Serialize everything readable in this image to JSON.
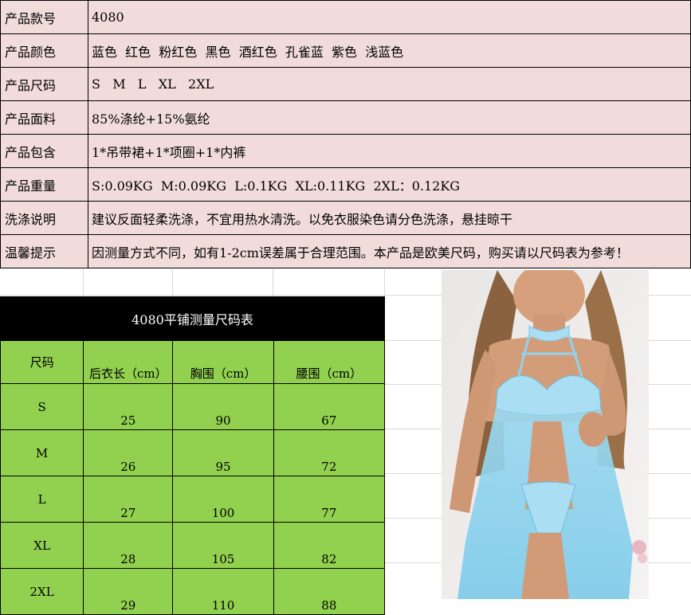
{
  "info_rows": [
    {
      "key": "产品款号",
      "value": "4080"
    },
    {
      "key": "产品颜色",
      "value": "蓝色  红色  粉红色  黑色  酒红色  孔雀蓝  紫色  浅蓝色"
    },
    {
      "key": "产品尺码",
      "value": "S   M   L   XL   2XL"
    },
    {
      "key": "产品面料",
      "value": "85%涤纶+15%氨纶"
    },
    {
      "key": "产品包含",
      "value": "1*吊带裙+1*项圈+1*内裤"
    },
    {
      "key": "产品重量",
      "value": "S:0.09KG  M:0.09KG  L:0.1KG  XL:0.11KG  2XL：0.12KG"
    },
    {
      "key": "洗涤说明",
      "value": "建议反面轻柔洗涤，不宜用热水清洗。以免衣服染色请分色洗涤，悬挂晾干"
    },
    {
      "key": "温馨提示",
      "value": "因测量方式不同，如有1-2cm误差属于合理范围。本产品是欧美尺码，购买请以尺码表为参考！"
    }
  ],
  "size_chart": {
    "title": "4080平铺测量尺码表",
    "headers": [
      "尺码",
      "后衣长（cm）",
      "胸围（cm）",
      "腰围（cm）"
    ],
    "rows": [
      [
        "S",
        "25",
        "90",
        "67"
      ],
      [
        "M",
        "26",
        "95",
        "72"
      ],
      [
        "L",
        "27",
        "100",
        "77"
      ],
      [
        "XL",
        "28",
        "105",
        "82"
      ],
      [
        "2XL",
        "29",
        "110",
        "88"
      ]
    ]
  },
  "colors": {
    "info_bg": "#f2dcdb",
    "chart_green": "#92d050",
    "chart_title_bg": "#000000",
    "garment_blue": "#8fd3ee",
    "lace_blue": "#a9def3",
    "skin": "#d9a07c"
  }
}
